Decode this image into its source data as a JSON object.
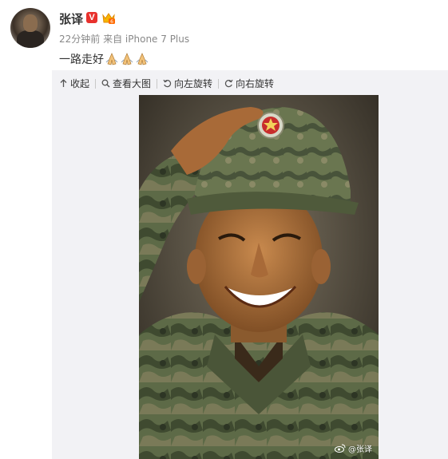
{
  "post": {
    "author_name": "张译",
    "verified_badge": "V",
    "time": "22分钟前",
    "source": "来自 iPhone 7 Plus",
    "text": "一路走好",
    "emoji": [
      "pray-hands-icon",
      "pray-hands-icon",
      "pray-hands-icon"
    ]
  },
  "toolbar": {
    "collapse_label": "收起",
    "view_large_label": "查看大图",
    "rotate_left_label": "向左旋转",
    "rotate_right_label": "向右旋转"
  },
  "image": {
    "watermark": "@张译"
  },
  "colors": {
    "name": "#333333",
    "meta": "#888888",
    "verified": "#e8312d",
    "media_bg": "#f2f2f5"
  }
}
